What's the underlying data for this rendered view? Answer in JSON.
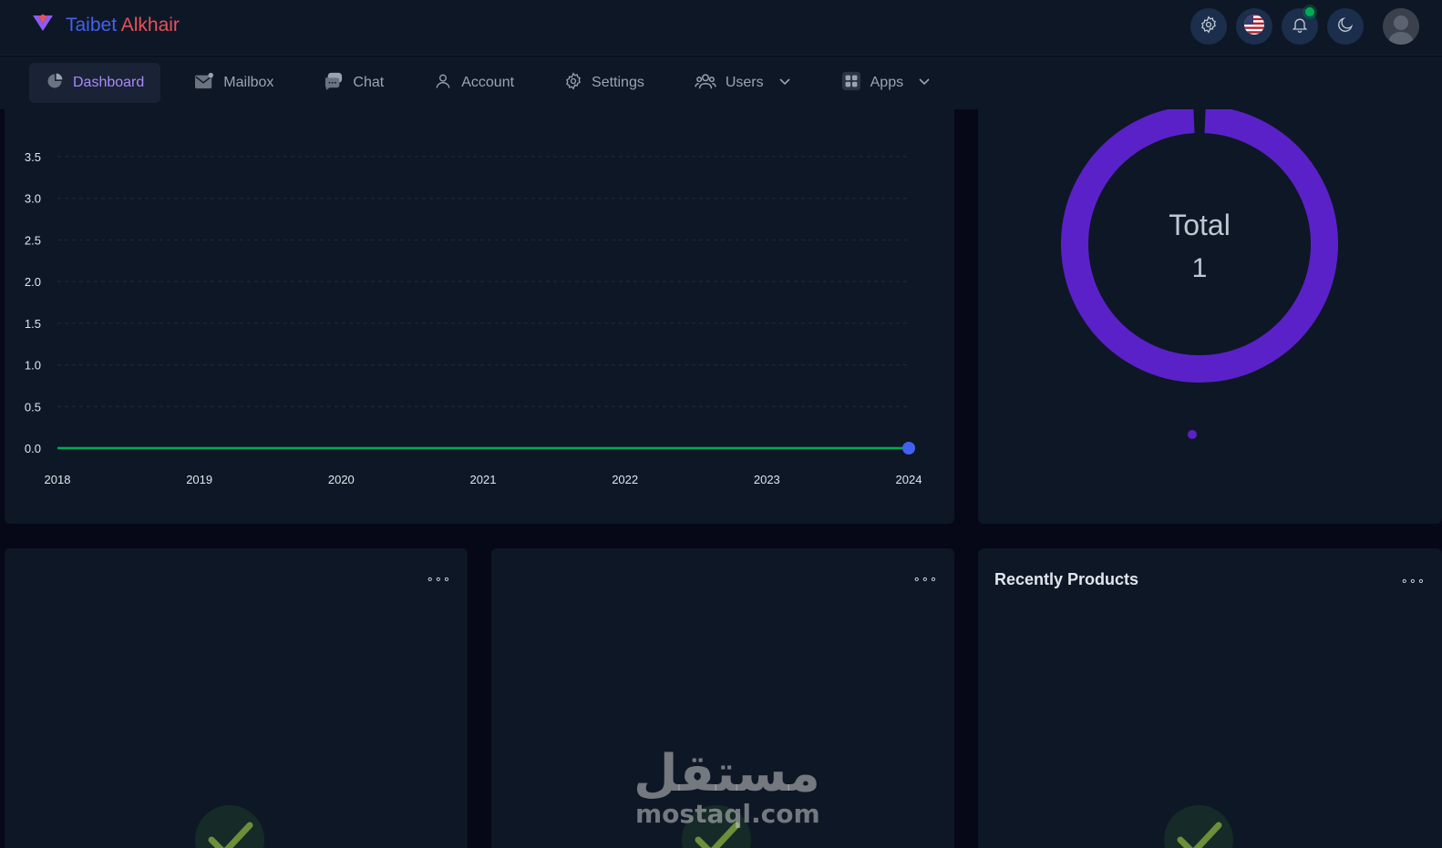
{
  "header": {
    "brand_part1": "Taibet",
    "brand_part2": "Alkhair",
    "icons": [
      "settings-icon",
      "us-flag-icon",
      "bell-icon",
      "moon-icon",
      "user-avatar"
    ],
    "notification_indicator_color": "#00ab55"
  },
  "nav": {
    "items": [
      {
        "label": "Dashboard",
        "icon": "pie-chart-icon",
        "active": true
      },
      {
        "label": "Mailbox",
        "icon": "mail-icon"
      },
      {
        "label": "Chat",
        "icon": "chat-icon"
      },
      {
        "label": "Account",
        "icon": "user-icon"
      },
      {
        "label": "Settings",
        "icon": "gear-icon"
      },
      {
        "label": "Users",
        "icon": "users-icon",
        "dropdown": true
      },
      {
        "label": "Apps",
        "icon": "apps-grid-icon",
        "dropdown": true
      }
    ]
  },
  "colors": {
    "background": "#060818",
    "panel": "#0e1726",
    "line_series": "#00ab55",
    "point": "#4361ee",
    "donut": "#5b21c8",
    "brand_blue": "#4361ee",
    "brand_red": "#e7515a"
  },
  "chart_data": [
    {
      "type": "line",
      "x": [
        "2018",
        "2019",
        "2020",
        "2021",
        "2022",
        "2023",
        "2024"
      ],
      "series": [
        {
          "values": [
            0,
            0,
            0,
            0,
            0,
            0,
            0
          ]
        }
      ],
      "ylim": [
        0,
        3.5
      ],
      "yticks": [
        "0.0",
        "0.5",
        "1.0",
        "1.5",
        "2.0",
        "2.5",
        "3.0",
        "3.5"
      ],
      "grid": true,
      "highlighted_point": {
        "x": "2024",
        "y": 0
      }
    },
    {
      "type": "pie",
      "variant": "donut",
      "center_label": "Total",
      "center_value": "1",
      "slices": [
        {
          "value": 1
        }
      ]
    }
  ],
  "cards": [
    {
      "title": "",
      "menu": "∘∘∘"
    },
    {
      "title": "",
      "menu": "∘∘∘"
    },
    {
      "title": "Recently Products",
      "menu": "∘∘∘"
    }
  ],
  "watermark": {
    "arabic": "مستقل",
    "latin": "mostaql.com"
  }
}
